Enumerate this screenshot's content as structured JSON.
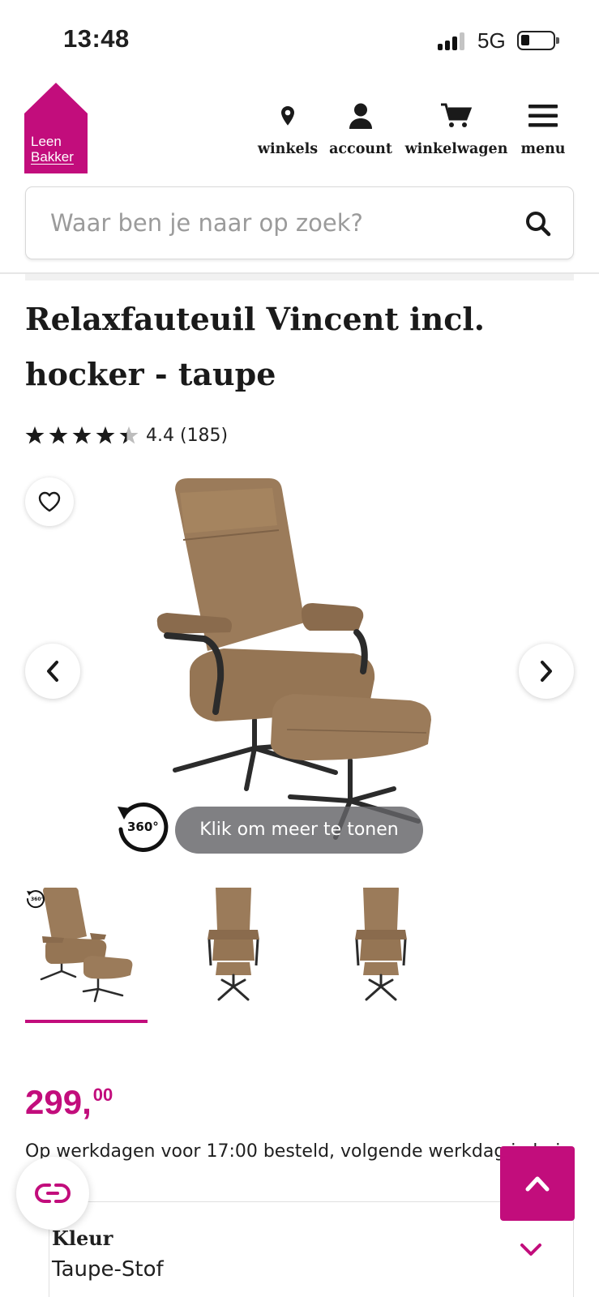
{
  "status_bar": {
    "time": "13:48",
    "network": "5G",
    "signal_bars_active": 3,
    "signal_bars_total": 4,
    "battery_level": 0.2
  },
  "header": {
    "logo": {
      "line1": "Leen",
      "line2": "Bakker"
    },
    "nav": [
      {
        "label": "winkels",
        "icon": "location-pin-icon"
      },
      {
        "label": "account",
        "icon": "user-icon"
      },
      {
        "label": "winkelwagen",
        "icon": "cart-icon"
      },
      {
        "label": "menu",
        "icon": "hamburger-icon"
      }
    ]
  },
  "search": {
    "placeholder": "Waar ben je naar op zoek?",
    "value": "",
    "icon": "search-icon"
  },
  "product": {
    "title": "Relaxfauteuil Vincent incl. hocker - taupe",
    "rating": {
      "value": 4.4,
      "max": 5,
      "text": "4.4 (185)"
    },
    "image": {
      "label_360": "360°",
      "show_more": "Klik om meer te tonen"
    },
    "thumbnails": [
      {
        "view": "side",
        "active": true,
        "has_360": true
      },
      {
        "view": "front",
        "active": false
      },
      {
        "view": "front",
        "active": false
      }
    ],
    "price": {
      "main": "299,",
      "cents": "00"
    },
    "delivery_text": "Op werkdagen voor 17:00 besteld, volgende werkdag in huis",
    "color": {
      "label": "Kleur",
      "value": "Taupe-Stof"
    }
  },
  "colors": {
    "brand": "#c20d7c",
    "text": "#1f1f1f",
    "upholstery": "#9b7b5a",
    "frame": "#2b2b2b"
  }
}
